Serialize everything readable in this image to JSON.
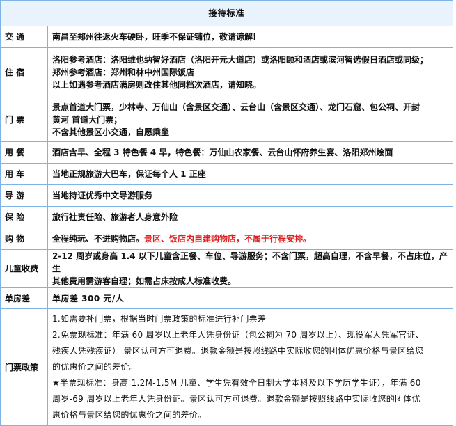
{
  "title": "接待标准",
  "rows": {
    "transport": {
      "label": "交  通",
      "lines": [
        "南昌至郑州往返火车硬卧，旺季不保证铺位，敬请谅解!"
      ]
    },
    "hotel": {
      "label": "住  宿",
      "lines": [
        "洛阳参考酒店：洛阳维也纳智好酒店（洛阳开元大道店）或洛阳颐和酒店或滨河智选假日酒店或同级；",
        "郑州参考酒店：郑州和林中州国际饭店",
        "以上如遇参考酒店满房则改住其他同档次酒店，请知晓。"
      ]
    },
    "tickets": {
      "label": "门  票",
      "lines": [
        "景点首道大门票，少林寺、万仙山（含景区交通）、云台山（含景区交通）、龙门石窟、包公祠、开封",
        "黄河  首道大门票；",
        "不含其他景区小交通，自愿乘坐"
      ]
    },
    "meals": {
      "label": "用  餐",
      "lines": [
        "酒店含早、全程 3 特色餐 4 早，特色餐：万仙山农家餐、云台山怀府养生宴、洛阳郑州烩面"
      ]
    },
    "vehicle": {
      "label": "用  车",
      "lines": [
        "当地正规旅游大巴车，保证每个人 1 正座"
      ]
    },
    "guide": {
      "label": "导  游",
      "lines": [
        "当地持证优秀中文导游服务"
      ]
    },
    "insurance": {
      "label": "保  险",
      "lines": [
        "旅行社责任险、旅游者人身意外险"
      ]
    },
    "shopping": {
      "label": "购  物",
      "text": "全程纯玩、不进购物店。",
      "red_text": "景区、饭店内自建购物店，不属于行程安排。"
    },
    "child": {
      "label": "儿童收费",
      "lines": [
        "2-12 周岁或身高 1.4 以下儿童含正餐、车位、导游服务；不含门票，超高自理，不含早餐，不占床位，产生",
        "其他费用需游客自理；如需占床按成人标准收费。"
      ]
    },
    "single": {
      "label": "单房差",
      "text": "单房差 300 元/人"
    },
    "policy": {
      "label": "门票政策",
      "lines": [
        "1.如需要补门票，根据当时门票政策的标准进行补门票差",
        "2.免票现标准：年满 60 周岁以上老年人凭身份证（包公祠为 70 周岁以上）、现役军人凭军官证、",
        "残疾人凭残疾证）  景区认可方可退费。退款金额是按照线路中实际收您的团体优惠价格与景区给您",
        "的优惠价之间的差价。",
        "★半票现标准：身高  1.2M-1.5M 儿童、学生凭有效全日制大学本科及以下学历学生证），年满  60",
        "周岁-69  周岁以上老年人凭身份证。景区认可方可退费。退款金额是按照线路中实际收您的团体优",
        "惠价格与景区给您的优惠价之间的差价。"
      ]
    }
  },
  "colors": {
    "border": "#7fb3e6",
    "title_bg": "#e9f3fd",
    "title_text": "#1a62c7",
    "highlight": "#e0201f"
  }
}
